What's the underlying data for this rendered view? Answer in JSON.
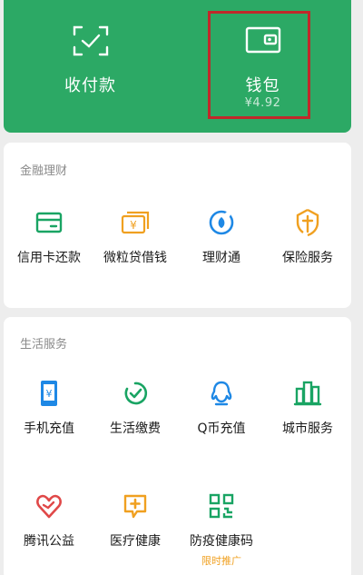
{
  "wallet": {
    "pay_label": "收付款",
    "wallet_label": "钱包",
    "balance": "¥4.92"
  },
  "finance": {
    "title": "金融理财",
    "items": [
      {
        "label": "信用卡还款",
        "icon": "credit-card-icon",
        "color": "#19a463"
      },
      {
        "label": "微粒贷借钱",
        "icon": "money-bag-icon",
        "color": "#f0a020"
      },
      {
        "label": "理财通",
        "icon": "wealth-icon",
        "color": "#1e88e5"
      },
      {
        "label": "保险服务",
        "icon": "insurance-icon",
        "color": "#f0a020"
      }
    ]
  },
  "life": {
    "title": "生活服务",
    "items": [
      {
        "label": "手机充值",
        "icon": "phone-recharge-icon",
        "color": "#1e88e5"
      },
      {
        "label": "生活缴费",
        "icon": "utility-payment-icon",
        "color": "#19a463"
      },
      {
        "label": "Q币充值",
        "icon": "qq-coin-icon",
        "color": "#1e88e5"
      },
      {
        "label": "城市服务",
        "icon": "city-service-icon",
        "color": "#19a463"
      },
      {
        "label": "腾讯公益",
        "icon": "charity-icon",
        "color": "#e04848"
      },
      {
        "label": "医疗健康",
        "icon": "medical-icon",
        "color": "#f0a020"
      },
      {
        "label": "防疫健康码",
        "icon": "health-code-icon",
        "color": "#19a463"
      }
    ],
    "promo": "限时推广"
  }
}
